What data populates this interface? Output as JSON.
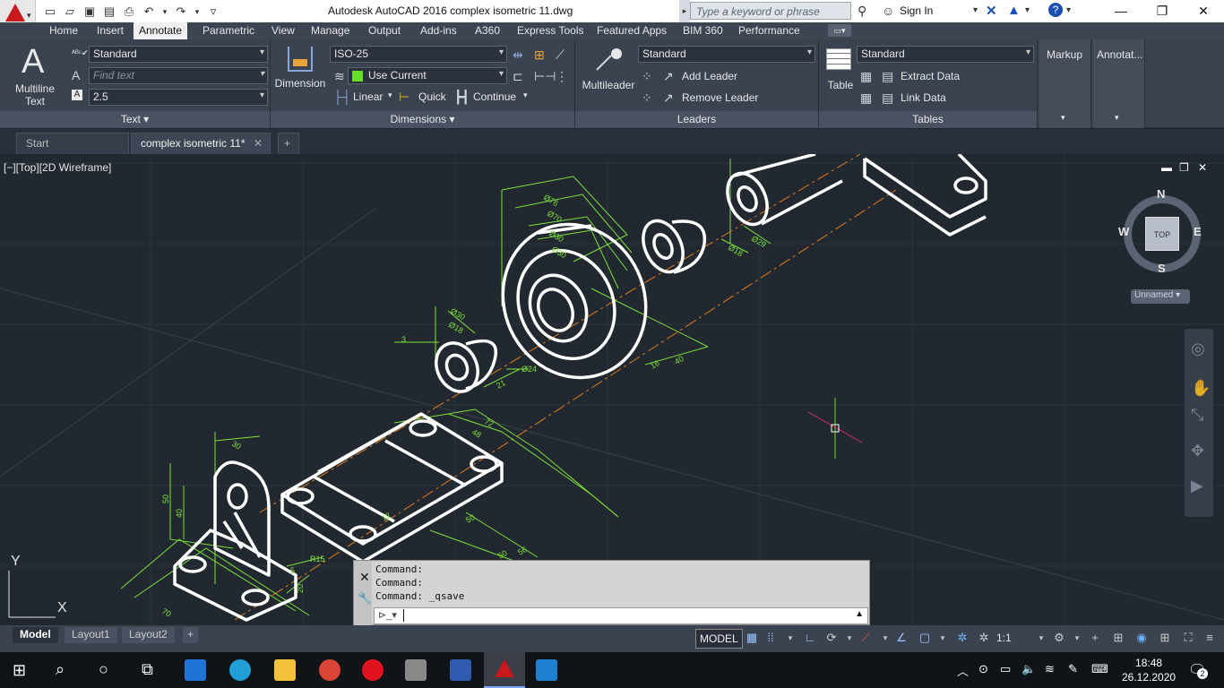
{
  "titlebar": {
    "title": "Autodesk AutoCAD 2016    complex isometric 11.dwg",
    "search_placeholder": "Type a keyword or phrase",
    "signin": "Sign In"
  },
  "ribbon_tabs": [
    "Home",
    "Insert",
    "Annotate",
    "Parametric",
    "View",
    "Manage",
    "Output",
    "Add-ins",
    "A360",
    "Express Tools",
    "Featured Apps",
    "BIM 360",
    "Performance"
  ],
  "active_tab": "Annotate",
  "text_panel": {
    "big_button": "Multiline Text",
    "style": "Standard",
    "find_placeholder": "Find text",
    "height": "2.5",
    "title": "Text"
  },
  "dimension_panel": {
    "big_button": "Dimension",
    "style": "ISO-25",
    "layer": "Use Current",
    "linear": "Linear",
    "quick": "Quick",
    "continue": "Continue",
    "title": "Dimensions"
  },
  "leaders_panel": {
    "big_button": "Multileader",
    "style": "Standard",
    "add": "Add Leader",
    "remove": "Remove Leader",
    "title": "Leaders"
  },
  "tables_panel": {
    "big_button": "Table",
    "style": "Standard",
    "extract": "Extract Data",
    "link": "Link Data",
    "title": "Tables"
  },
  "markup_panel": {
    "title": "Markup"
  },
  "annotation_panel": {
    "title": "Annotat..."
  },
  "file_tabs": [
    "Start",
    "complex isometric 11*"
  ],
  "viewport": {
    "label": "[−][Top][2D Wireframe]",
    "viewcube": {
      "n": "N",
      "s": "S",
      "e": "E",
      "w": "W",
      "top": "TOP",
      "ucs": "Unnamed"
    },
    "axis_y": "Y",
    "axis_x": "X",
    "dims": [
      "Ø76",
      "Ø70",
      "Ø30",
      "Ø30",
      "Ø18",
      "Ø24",
      "21",
      "16",
      "40",
      "Ø18",
      "Ø29",
      "3",
      "72",
      "48",
      "50",
      "50",
      "56",
      "50",
      "40",
      "30",
      "R15",
      "5",
      "70",
      "20",
      "12"
    ]
  },
  "command": {
    "history": [
      "Command:",
      "Command:",
      "Command:  _qsave"
    ]
  },
  "layout_tabs": [
    "Model",
    "Layout1",
    "Layout2"
  ],
  "status": {
    "model": "MODEL",
    "scale": "1:1"
  },
  "clock": {
    "time": "18:48",
    "date": "26.12.2020"
  },
  "notifications": "2"
}
